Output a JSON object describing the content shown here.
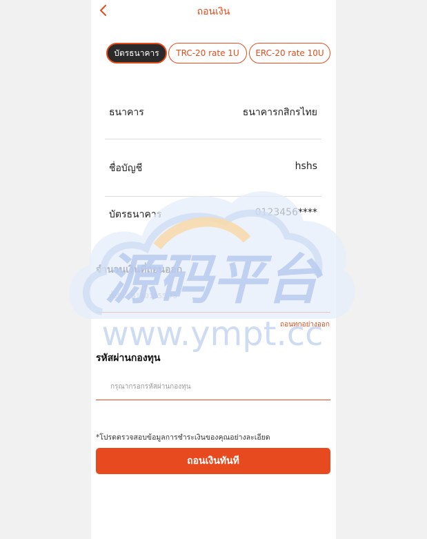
{
  "header": {
    "title": "ถอนเงิน",
    "back_icon": "chevron-left-icon"
  },
  "tabs": [
    {
      "label": "บัตรธนาคาร",
      "active": true
    },
    {
      "label": "TRC-20 rate 1U",
      "active": false
    },
    {
      "label": "ERC-20 rate 10U",
      "active": false
    }
  ],
  "info_rows": [
    {
      "label": "ธนาคาร",
      "value": "ธนาคารกสิกรไทย"
    },
    {
      "label": "ชื่อบัญชี",
      "value": "hshs"
    },
    {
      "label": "บัตรธนาคาร",
      "value": "0123456****"
    }
  ],
  "amount": {
    "title": "จำนวนเงินที่ถอนออก",
    "display": "ทั้งปัง : ฿1101555.75",
    "withdraw_all": "ถอนทุกอย่างออก"
  },
  "password": {
    "title": "รหัสผ่านกองทุน",
    "placeholder": "กรุณากรอกรหัสผ่านกองทุน"
  },
  "note": "*โปรดตรวจสอบข้อมูลการชำระเงินของคุณอย่างละเอียด",
  "submit_label": "ถอนเงินทันที",
  "watermark": {
    "chinese": "源码平台",
    "url": "www.ympt.cc"
  },
  "colors": {
    "accent": "#e64a19",
    "active_tab_bg": "#2a2a2a"
  }
}
